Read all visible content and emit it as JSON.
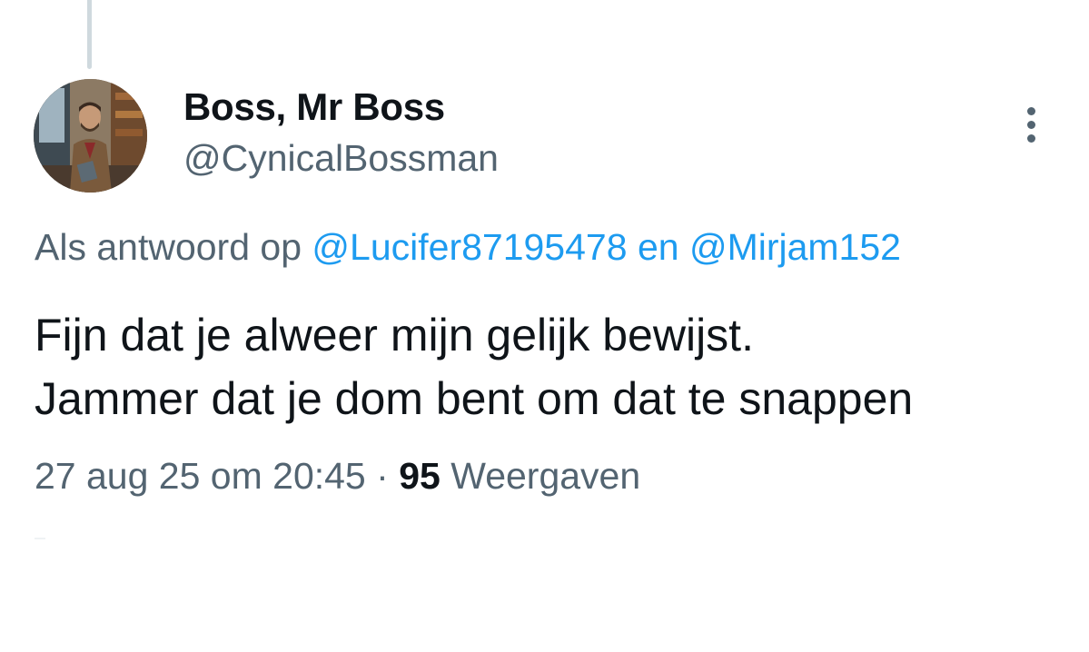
{
  "tweet": {
    "author": {
      "display_name": "Boss, Mr Boss",
      "handle": "@CynicalBossman",
      "avatar_icon": "profile-photo"
    },
    "more_icon": "more-vertical-icon",
    "reply_context": {
      "prefix": "Als antwoord op",
      "mention_1": "@Lucifer87195478",
      "conjunction": "en",
      "mention_2": "@Mirjam152"
    },
    "text_lines": [
      "Fijn dat je alweer mijn gelijk bewijst.",
      "Jammer dat je dom bent om dat te snappen"
    ],
    "timestamp": "27 aug 25 om 20:45",
    "separator": "·",
    "views_count": "95",
    "views_label": "Weergaven"
  },
  "colors": {
    "text_primary": "#0f1419",
    "text_secondary": "#536471",
    "link": "#1d9bf0",
    "thread_line": "#cfd9de"
  }
}
